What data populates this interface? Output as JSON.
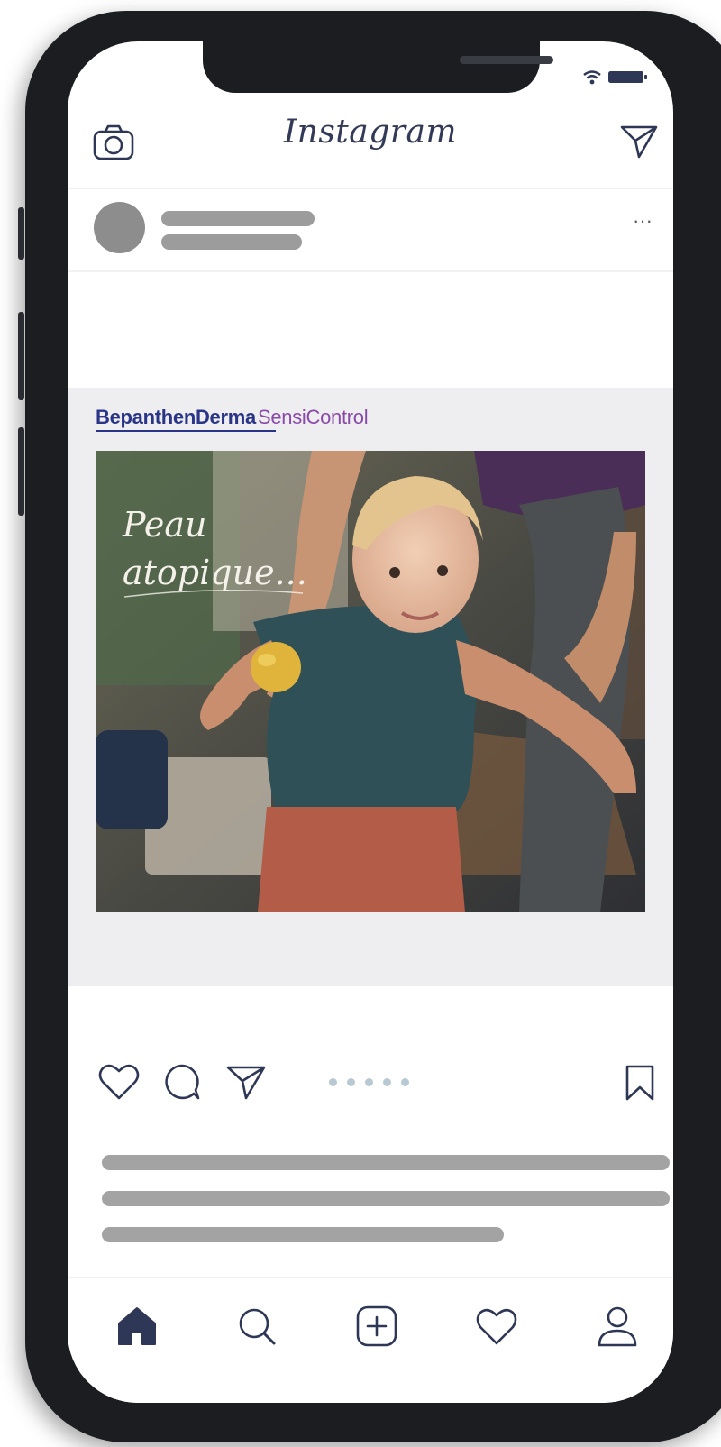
{
  "app": {
    "title": "Instagram"
  },
  "post": {
    "more_label": "···",
    "ad": {
      "brand_main": "BepanthenDerma",
      "brand_sub": "SensiControl",
      "image_caption": "Peau atopique..."
    },
    "carousel": {
      "total": 5,
      "active": 1
    }
  },
  "nav": {
    "items": [
      "home",
      "search",
      "add",
      "activity",
      "profile"
    ],
    "active": "home"
  },
  "colors": {
    "icon": "#2f3757",
    "brand_main": "#2b3588",
    "brand_sub": "#8a4aa7",
    "skeleton": "#9c9c9c"
  },
  "icons": [
    "camera-icon",
    "send-icon",
    "heart-icon",
    "comment-icon",
    "bookmark-icon",
    "home-icon",
    "search-icon",
    "plus-icon",
    "profile-icon"
  ]
}
